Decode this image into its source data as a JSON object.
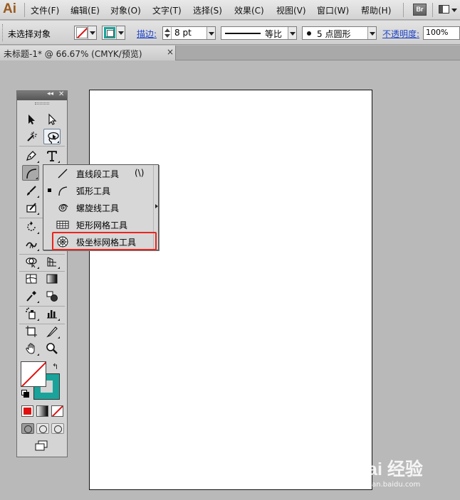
{
  "app": {
    "logo": "Ai",
    "bridge_label": "Br"
  },
  "menu": {
    "items": [
      "文件(F)",
      "编辑(E)",
      "对象(O)",
      "文字(T)",
      "选择(S)",
      "效果(C)",
      "视图(V)",
      "窗口(W)",
      "帮助(H)"
    ]
  },
  "control_bar": {
    "selection_status": "未选择对象",
    "stroke_label": "描边:",
    "stroke_weight": "8 pt",
    "stroke_profile": "等比",
    "brush": "5 点圆形",
    "opacity_label": "不透明度:",
    "opacity_value": "100%",
    "colors": {
      "fill": "#ffffff",
      "stroke": "#1aa39a",
      "none_slash": "#e01010"
    }
  },
  "document_tab": {
    "title": "未标题-1* @ 66.67% (CMYK/预览)",
    "close": "×"
  },
  "tools_panel": {
    "collapse_glyph": "◂◂",
    "close_glyph": "✕",
    "tools": [
      "selection-tool",
      "direct-selection-tool",
      "magic-wand-tool",
      "lasso-tool",
      "pen-tool",
      "type-tool",
      "arc-tool",
      "brush-tool",
      "blob-brush-tool",
      "rotate-tool",
      "width-tool",
      "warp-tool",
      "free-transform-tool",
      "mesh-tool",
      "gradient-tool",
      "eyedropper-tool",
      "blend-tool",
      "symbol-sprayer-tool",
      "graph-tool",
      "artboard-tool",
      "slice-tool",
      "hand-tool",
      "zoom-tool"
    ],
    "swap_glyph": "↰"
  },
  "flyout": {
    "items": [
      {
        "label": "直线段工具",
        "shortcut": "(\\)",
        "icon": "line-segment-icon",
        "active": false
      },
      {
        "label": "弧形工具",
        "shortcut": "",
        "icon": "arc-icon",
        "active": true
      },
      {
        "label": "螺旋线工具",
        "shortcut": "",
        "icon": "spiral-icon",
        "active": false
      },
      {
        "label": "矩形网格工具",
        "shortcut": "",
        "icon": "rectangular-grid-icon",
        "active": false
      },
      {
        "label": "极坐标网格工具",
        "shortcut": "",
        "icon": "polar-grid-icon",
        "active": false,
        "highlighted": true
      }
    ],
    "highlight_color": "#e8261f"
  },
  "watermark": {
    "main": "Bai 经验",
    "sub": "jingyan.baidu.com"
  }
}
